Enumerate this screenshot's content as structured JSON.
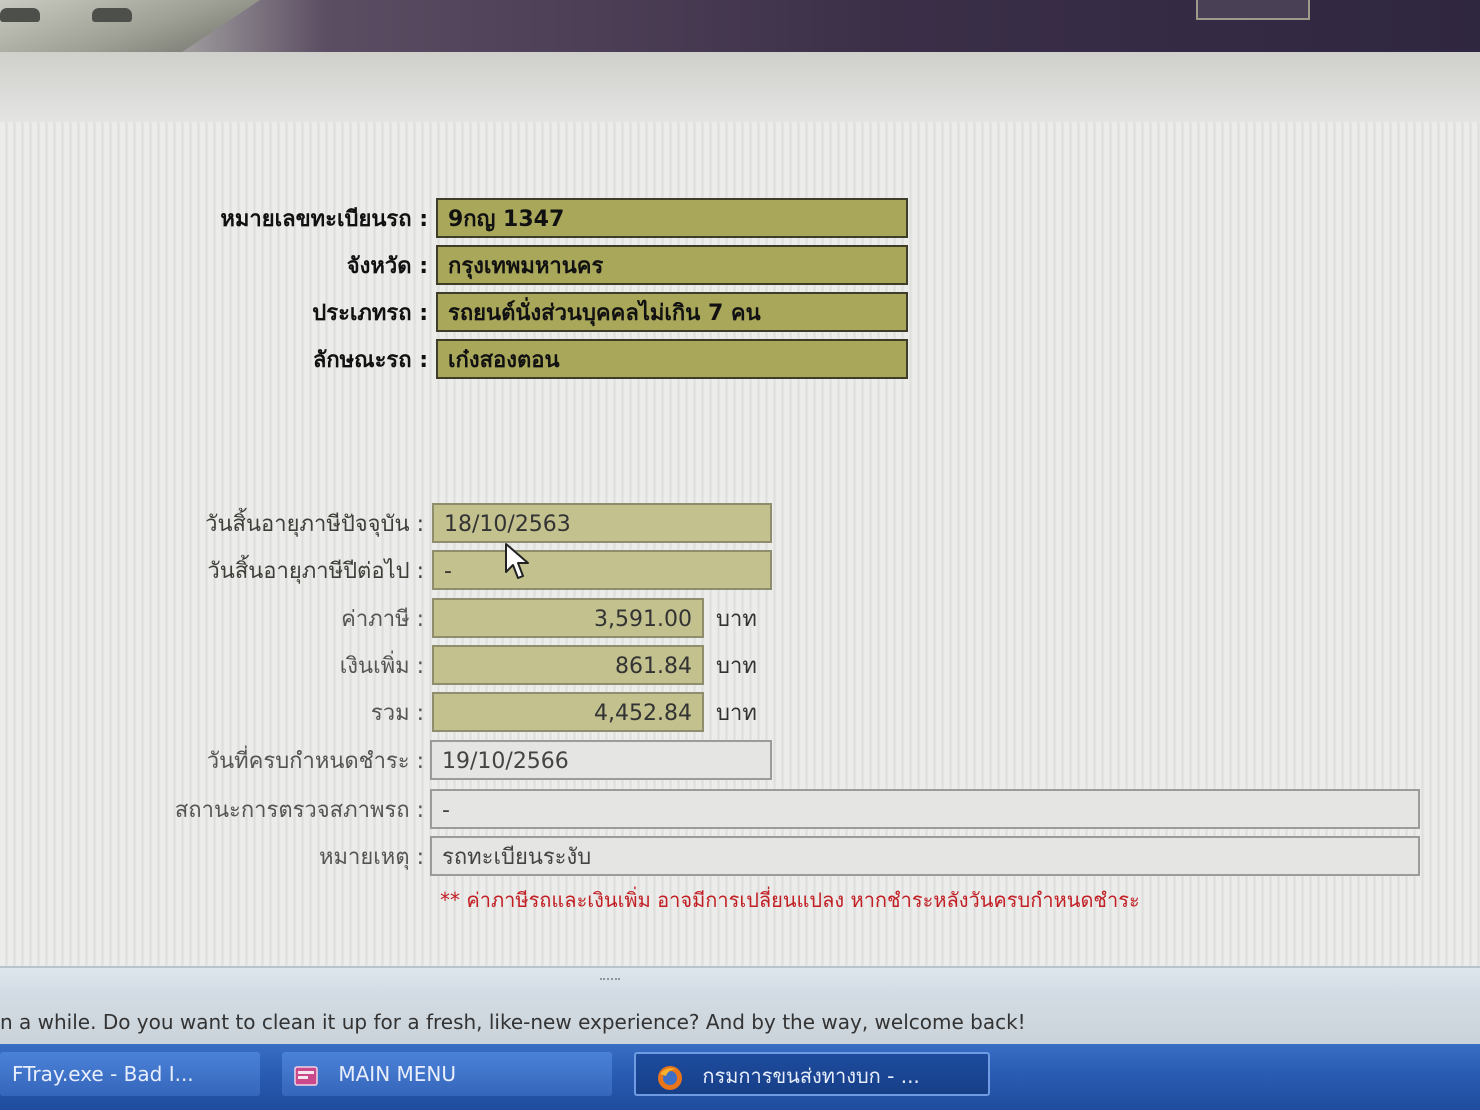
{
  "vehicle": {
    "plate_label": "หมายเลขทะเบียนรถ :",
    "plate_value": "9กญ 1347",
    "province_label": "จังหวัด :",
    "province_value": "กรุงเทพมหานคร",
    "type_label": "ประเภทรถ :",
    "type_value": "รถยนต์นั่งส่วนบุคคลไม่เกิน 7 คน",
    "body_label": "ลักษณะรถ :",
    "body_value": "เก๋งสองตอน"
  },
  "tax": {
    "current_expiry_label": "วันสิ้นอายุภาษีปัจจุบัน :",
    "current_expiry_value": "18/10/2563",
    "next_expiry_label": "วันสิ้นอายุภาษีปีต่อไป :",
    "next_expiry_value": "-",
    "tax_label": "ค่าภาษี :",
    "tax_value": "3,591.00",
    "surcharge_label": "เงินเพิ่ม :",
    "surcharge_value": "861.84",
    "total_label": "รวม :",
    "total_value": "4,452.84",
    "unit": "บาท",
    "due_date_label": "วันที่ครบกำหนดชำระ :",
    "due_date_value": "19/10/2566",
    "inspection_label": "สถานะการตรวจสภาพรถ :",
    "inspection_value": "-",
    "remark_label": "หมายเหตุ :",
    "remark_value": "รถทะเบียนระงับ",
    "warning_note": "** ค่าภาษีรถและเงินเพิ่ม อาจมีการเปลี่ยนแปลง หากชำระหลังวันครบกำหนดชำระ"
  },
  "notification": {
    "text": "n a while. Do you want to clean it up for a fresh, like-new experience? And by the way, welcome back!"
  },
  "taskbar": {
    "items": [
      {
        "label": "FTray.exe - Bad I...",
        "icon": "error-app-icon"
      },
      {
        "label": "MAIN MENU",
        "icon": "app-window-icon"
      },
      {
        "label": "กรมการขนส่งทางบก - ...",
        "icon": "firefox-icon"
      }
    ]
  },
  "colors": {
    "primary_field": "#a9a75a",
    "secondary_field": "#c3c28f",
    "warning": "#c21f24",
    "taskbar": "#2a5db5"
  }
}
